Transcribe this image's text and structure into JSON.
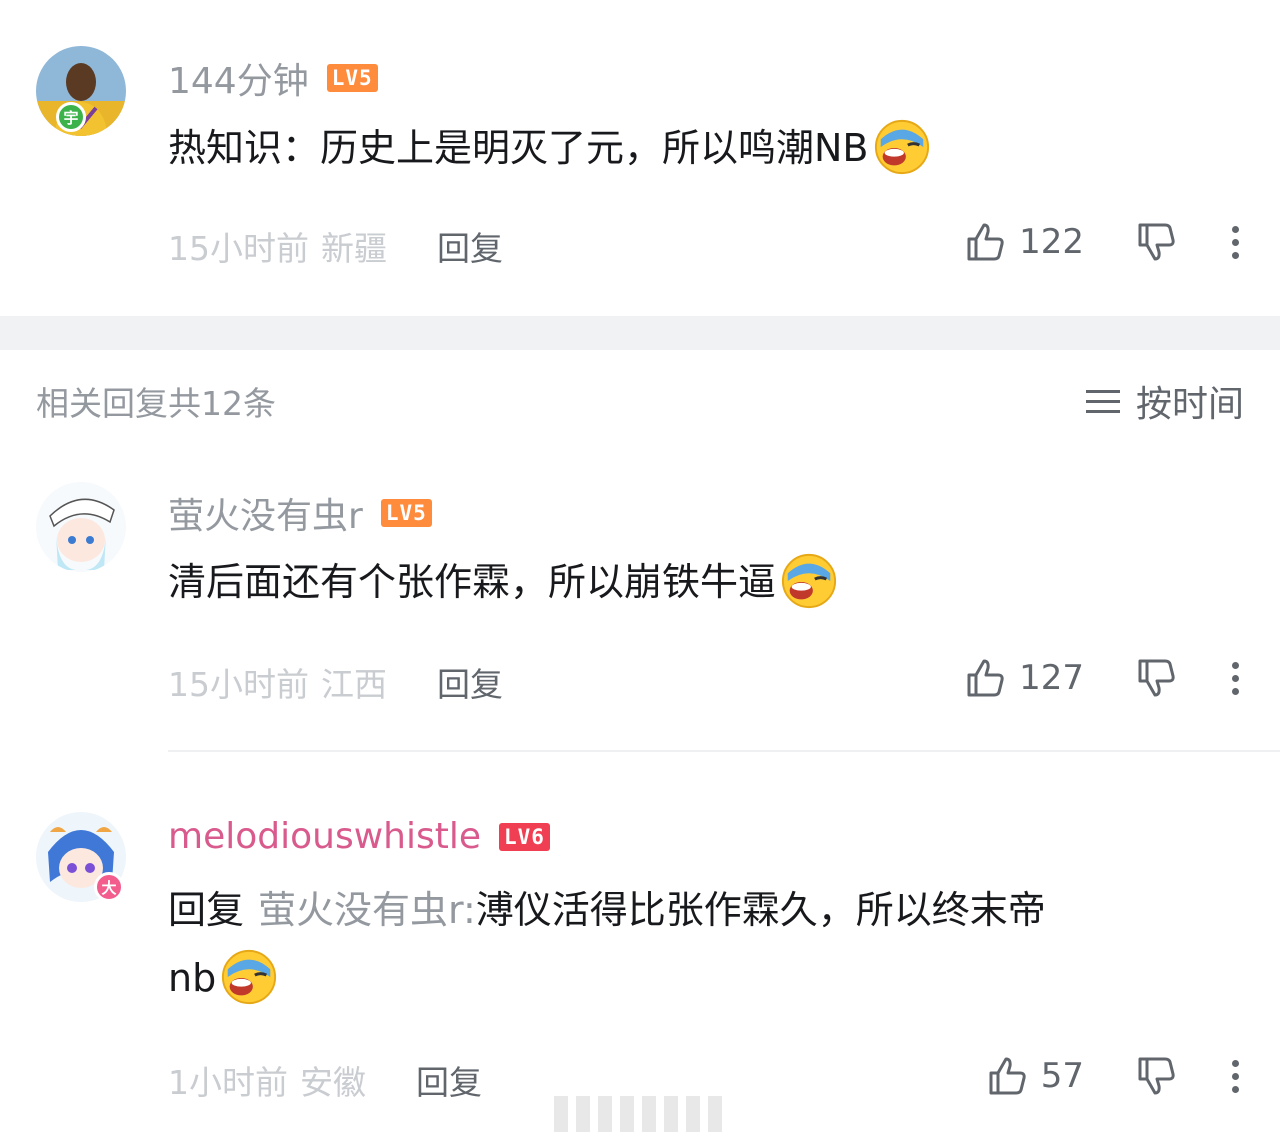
{
  "main_comment": {
    "username": "144分钟",
    "level": "LV5",
    "avatar_badge": "宇",
    "text": "热知识：历史上是明灭了元，所以鸣潮NB",
    "time": "15小时前",
    "location": "新疆",
    "reply_label": "回复",
    "likes": "122"
  },
  "replies_header": {
    "count_text": "相关回复共12条",
    "sort_label": "按时间"
  },
  "replies": [
    {
      "username": "萤火没有虫r",
      "level": "LV5",
      "text": "清后面还有个张作霖，所以崩铁牛逼",
      "time": "15小时前",
      "location": "江西",
      "reply_label": "回复",
      "likes": "127"
    },
    {
      "username": "melodiouswhistle",
      "level": "LV6",
      "avatar_badge": "大",
      "reply_prefix": "回复",
      "mention": "萤火没有虫r:",
      "text": "溥仪活得比张作霖久，所以终末帝",
      "text_line2": "nb",
      "time": "1小时前",
      "location": "安徽",
      "reply_label": "回复",
      "likes": "57"
    }
  ],
  "colors": {
    "lv5": "#ff8b3d",
    "lv6": "#f03e52",
    "pink_username": "#d95a8d",
    "muted": "#9499a0",
    "separator": "#f1f2f3"
  },
  "icons": [
    "thumb-up-icon",
    "thumb-down-icon",
    "more-vertical-icon",
    "sort-lines-icon",
    "laughing-crying-emoji"
  ]
}
